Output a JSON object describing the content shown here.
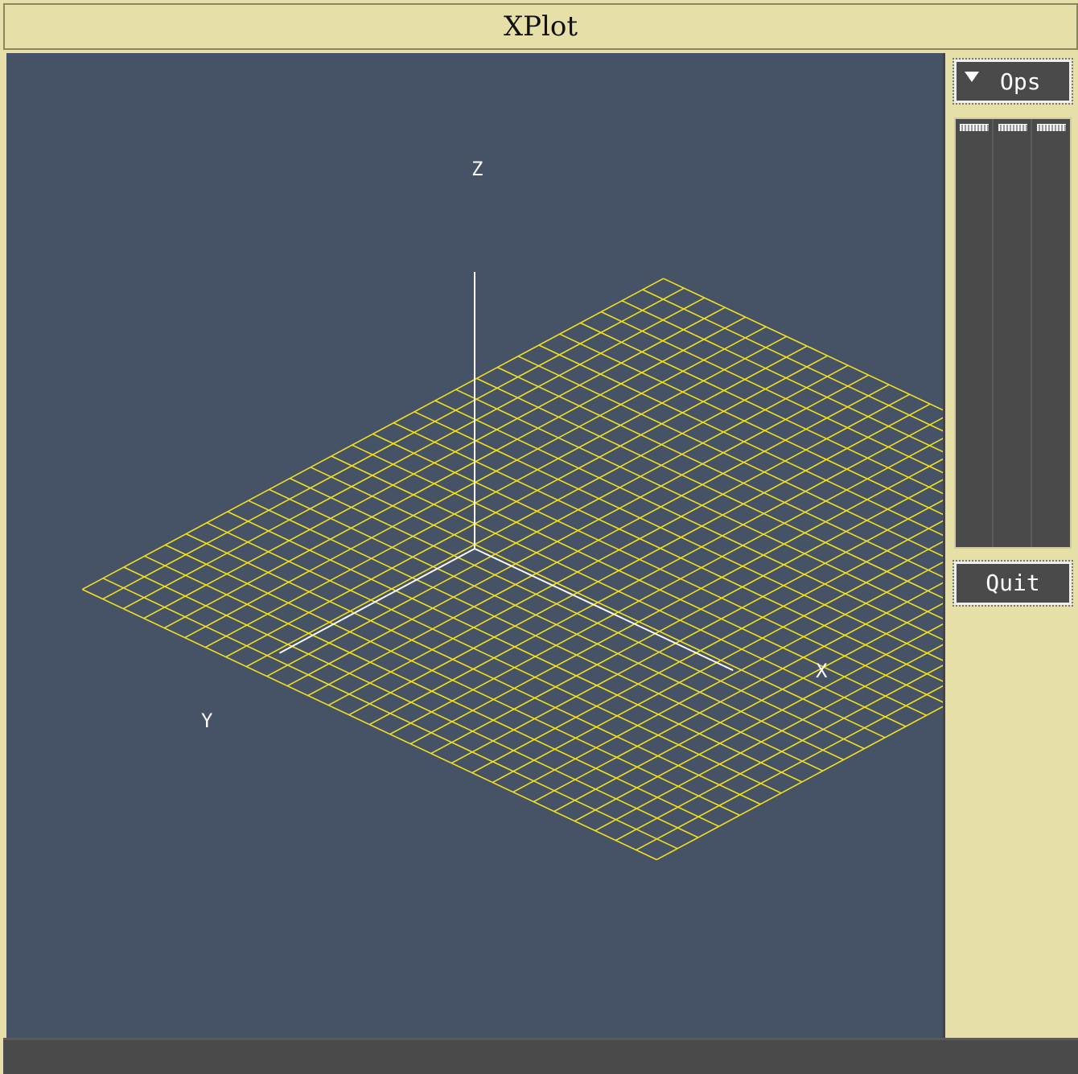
{
  "window": {
    "title": "XPlot"
  },
  "plot": {
    "background_color": "#465366",
    "grid_color": "#f0e020",
    "axis_color": "#ffffff",
    "grid_divisions": 16,
    "axis_labels": {
      "x": "X",
      "y": "Y",
      "z": "Z"
    }
  },
  "side_panel": {
    "ops_menu_label": "Ops",
    "ops_menu_icon": "dropdown-triangle-icon",
    "slider_count": 3,
    "quit_label": "Quit"
  },
  "status_bar": {
    "text": ""
  }
}
